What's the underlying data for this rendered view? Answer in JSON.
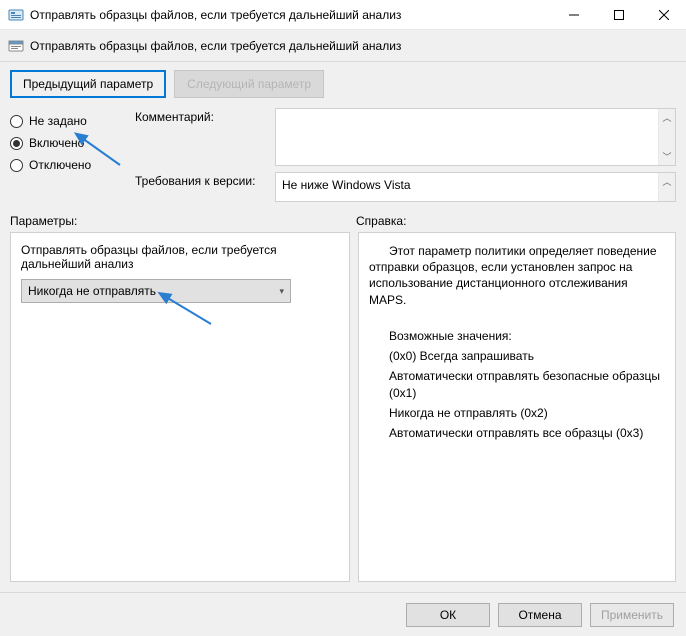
{
  "window": {
    "title": "Отправлять образцы файлов, если требуется дальнейший анализ"
  },
  "subheader": {
    "title": "Отправлять образцы файлов, если требуется дальнейший анализ"
  },
  "nav": {
    "prev": "Предыдущий параметр",
    "next": "Следующий параметр"
  },
  "radios": {
    "not_configured": "Не задано",
    "enabled": "Включено",
    "disabled": "Отключено",
    "selected": "enabled"
  },
  "fields": {
    "comment_label": "Комментарий:",
    "comment_value": "",
    "requirements_label": "Требования к версии:",
    "requirements_value": "Не ниже Windows Vista"
  },
  "panels": {
    "params_label": "Параметры:",
    "help_label": "Справка:"
  },
  "params": {
    "description": "Отправлять образцы файлов, если требуется дальнейший анализ",
    "combo_value": "Никогда не отправлять",
    "combo_options": [
      "Всегда запрашивать",
      "Автоматически отправлять безопасные образцы",
      "Никогда не отправлять",
      "Автоматически отправлять все образцы"
    ]
  },
  "help": {
    "intro": "Этот параметр политики определяет поведение отправки образцов, если установлен запрос на использование дистанционного отслеживания MAPS.",
    "options_heading": "Возможные значения:",
    "opt1": "(0x0) Всегда запрашивать",
    "opt2": "Автоматически отправлять безопасные образцы (0x1)",
    "opt3": "Никогда не отправлять (0x2)",
    "opt4": "Автоматически отправлять все образцы (0x3)"
  },
  "footer": {
    "ok": "ОК",
    "cancel": "Отмена",
    "apply": "Применить"
  }
}
